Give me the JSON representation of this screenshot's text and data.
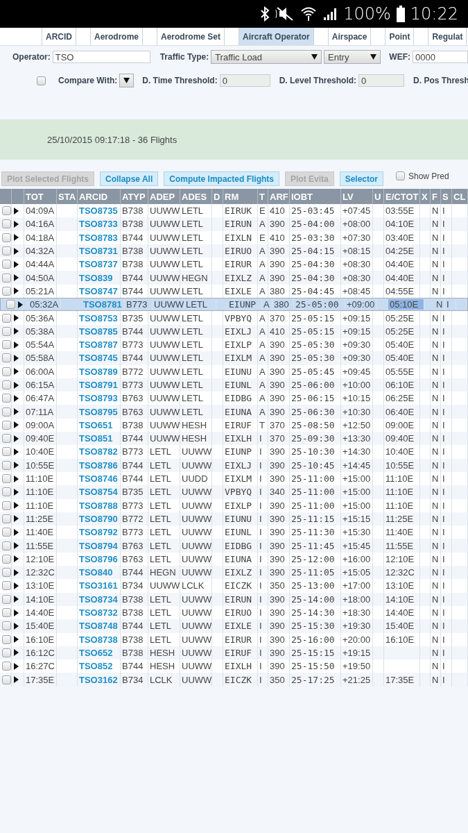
{
  "status_bar": {
    "battery": "100%",
    "time": "10:22"
  },
  "tabs": [
    {
      "label": "ARCID",
      "selected": false
    },
    {
      "label": "Aerodrome",
      "selected": false
    },
    {
      "label": "Aerodrome Set",
      "selected": false
    },
    {
      "label": "Aircraft Operator",
      "selected": true
    },
    {
      "label": "Airspace",
      "selected": false
    },
    {
      "label": "Point",
      "selected": false
    },
    {
      "label": "Regulat",
      "selected": false
    }
  ],
  "filters": {
    "operator": {
      "label": "Operator:",
      "value": "TSO"
    },
    "traffic_type": {
      "label": "Traffic Type:",
      "value": "Traffic Load",
      "mode": "Entry"
    },
    "wef": {
      "label": "WEF:",
      "value": "0000"
    },
    "compare": {
      "checked": false,
      "label": "Compare With:"
    },
    "time_threshold": {
      "label": "D. Time Threshold:",
      "value": "0"
    },
    "level_threshold": {
      "label": "D. Level Threshold:",
      "value": "0"
    },
    "pos_threshold": {
      "label": "D. Pos Thresh"
    }
  },
  "summary": "25/10/2015 09:17:18 - 36 Flights",
  "actions": [
    {
      "label": "Plot Selected Flights",
      "disabled": true
    },
    {
      "label": "Collapse All",
      "disabled": false
    },
    {
      "label": "Compute Impacted Flights",
      "disabled": false
    },
    {
      "label": "Plot Evita",
      "disabled": true
    },
    {
      "label": "Selector",
      "disabled": false
    }
  ],
  "show_pred": {
    "label": "Show Pred",
    "checked": false
  },
  "table": {
    "columns": [
      "TOT",
      "STA",
      "ARCID",
      "ATYP",
      "ADEP",
      "ADES",
      "D",
      "RM",
      "T",
      "ARF",
      "IOBT",
      "LV",
      "U",
      "E/CTOT",
      "X",
      "F",
      "S",
      "CL"
    ],
    "rows": [
      {
        "checked": false,
        "selected": false,
        "tot": "04:09A",
        "arcid": "TSO8735",
        "atyp": "B738",
        "adep": "UUWW",
        "ades": "LETL",
        "rm": "EIRUK",
        "t": "E",
        "arf": "410",
        "iobt": "25-03:45",
        "lv": "+07:45",
        "ctot": "03:55E",
        "f": "N",
        "s": "I"
      },
      {
        "checked": false,
        "selected": false,
        "tot": "04:16A",
        "arcid": "TSO8733",
        "atyp": "B738",
        "adep": "UUWW",
        "ades": "LETL",
        "rm": "EIRUN",
        "t": "A",
        "arf": "390",
        "iobt": "25-04:00",
        "lv": "+08:00",
        "ctot": "04:10E",
        "f": "N",
        "s": "I"
      },
      {
        "checked": false,
        "selected": false,
        "tot": "04:18A",
        "arcid": "TSO8783",
        "atyp": "B744",
        "adep": "UUWW",
        "ades": "LETL",
        "rm": "EIXLN",
        "t": "E",
        "arf": "410",
        "iobt": "25-03:30",
        "lv": "+07:30",
        "ctot": "03:40E",
        "f": "N",
        "s": "I"
      },
      {
        "checked": false,
        "selected": false,
        "tot": "04:32A",
        "arcid": "TSO8731",
        "atyp": "B738",
        "adep": "UUWW",
        "ades": "LETL",
        "rm": "EIRUO",
        "t": "A",
        "arf": "390",
        "iobt": "25-04:15",
        "lv": "+08:15",
        "ctot": "04:25E",
        "f": "N",
        "s": "I"
      },
      {
        "checked": false,
        "selected": false,
        "tot": "04:44A",
        "arcid": "TSO8737",
        "atyp": "B738",
        "adep": "UUWW",
        "ades": "LETL",
        "rm": "EIRUR",
        "t": "A",
        "arf": "390",
        "iobt": "25-04:30",
        "lv": "+08:30",
        "ctot": "04:40E",
        "f": "N",
        "s": "I"
      },
      {
        "checked": false,
        "selected": false,
        "tot": "04:50A",
        "arcid": "TSO839",
        "atyp": "B744",
        "adep": "UUWW",
        "ades": "HEGN",
        "rm": "EIXLZ",
        "t": "A",
        "arf": "390",
        "iobt": "25-04:30",
        "lv": "+08:30",
        "ctot": "04:40E",
        "f": "N",
        "s": "I"
      },
      {
        "checked": false,
        "selected": false,
        "tot": "05:21A",
        "arcid": "TSO8747",
        "atyp": "B744",
        "adep": "UUWW",
        "ades": "LETL",
        "rm": "EIXLE",
        "t": "A",
        "arf": "380",
        "iobt": "25-04:45",
        "lv": "+08:45",
        "ctot": "04:55E",
        "f": "N",
        "s": "I"
      },
      {
        "checked": false,
        "selected": true,
        "tot": "05:32A",
        "arcid": "TSO8781",
        "atyp": "B773",
        "adep": "UUWW",
        "ades": "LETL",
        "rm": "EIUNP",
        "t": "A",
        "arf": "380",
        "iobt": "25-05:00",
        "lv": "+09:00",
        "ctot": "05:10E",
        "f": "N",
        "s": "I"
      },
      {
        "checked": false,
        "selected": false,
        "tot": "05:36A",
        "arcid": "TSO8753",
        "atyp": "B735",
        "adep": "UUWW",
        "ades": "LETL",
        "rm": "VPBYQ",
        "t": "A",
        "arf": "370",
        "iobt": "25-05:15",
        "lv": "+09:15",
        "ctot": "05:25E",
        "f": "N",
        "s": "I"
      },
      {
        "checked": false,
        "selected": false,
        "tot": "05:38A",
        "arcid": "TSO8785",
        "atyp": "B744",
        "adep": "UUWW",
        "ades": "LETL",
        "rm": "EIXLJ",
        "t": "A",
        "arf": "410",
        "iobt": "25-05:15",
        "lv": "+09:15",
        "ctot": "05:25E",
        "f": "N",
        "s": "I"
      },
      {
        "checked": false,
        "selected": false,
        "tot": "05:54A",
        "arcid": "TSO8787",
        "atyp": "B773",
        "adep": "UUWW",
        "ades": "LETL",
        "rm": "EIXLP",
        "t": "A",
        "arf": "390",
        "iobt": "25-05:30",
        "lv": "+09:30",
        "ctot": "05:40E",
        "f": "N",
        "s": "I"
      },
      {
        "checked": false,
        "selected": false,
        "tot": "05:58A",
        "arcid": "TSO8745",
        "atyp": "B744",
        "adep": "UUWW",
        "ades": "LETL",
        "rm": "EIXLM",
        "t": "A",
        "arf": "390",
        "iobt": "25-05:30",
        "lv": "+09:30",
        "ctot": "05:40E",
        "f": "N",
        "s": "I"
      },
      {
        "checked": false,
        "selected": false,
        "tot": "06:00A",
        "arcid": "TSO8789",
        "atyp": "B772",
        "adep": "UUWW",
        "ades": "LETL",
        "rm": "EIUNU",
        "t": "A",
        "arf": "390",
        "iobt": "25-05:45",
        "lv": "+09:45",
        "ctot": "05:55E",
        "f": "N",
        "s": "I"
      },
      {
        "checked": false,
        "selected": false,
        "tot": "06:15A",
        "arcid": "TSO8791",
        "atyp": "B773",
        "adep": "UUWW",
        "ades": "LETL",
        "rm": "EIUNL",
        "t": "A",
        "arf": "390",
        "iobt": "25-06:00",
        "lv": "+10:00",
        "ctot": "06:10E",
        "f": "N",
        "s": "I"
      },
      {
        "checked": false,
        "selected": false,
        "tot": "06:47A",
        "arcid": "TSO8793",
        "atyp": "B763",
        "adep": "UUWW",
        "ades": "LETL",
        "rm": "EIDBG",
        "t": "A",
        "arf": "390",
        "iobt": "25-06:15",
        "lv": "+10:15",
        "ctot": "06:25E",
        "f": "N",
        "s": "I"
      },
      {
        "checked": false,
        "selected": false,
        "tot": "07:11A",
        "arcid": "TSO8795",
        "atyp": "B763",
        "adep": "UUWW",
        "ades": "LETL",
        "rm": "EIUNA",
        "t": "A",
        "arf": "390",
        "iobt": "25-06:30",
        "lv": "+10:30",
        "ctot": "06:40E",
        "f": "N",
        "s": "I"
      },
      {
        "checked": false,
        "selected": false,
        "tot": "09:00A",
        "arcid": "TSO651",
        "atyp": "B738",
        "adep": "UUWW",
        "ades": "HESH",
        "rm": "EIRUF",
        "t": "T",
        "arf": "370",
        "iobt": "25-08:50",
        "lv": "+12:50",
        "ctot": "09:00E",
        "f": "N",
        "s": "I"
      },
      {
        "checked": false,
        "selected": false,
        "tot": "09:40E",
        "arcid": "TSO851",
        "atyp": "B744",
        "adep": "UUWW",
        "ades": "HESH",
        "rm": "EIXLH",
        "t": "I",
        "arf": "370",
        "iobt": "25-09:30",
        "lv": "+13:30",
        "ctot": "09:40E",
        "f": "N",
        "s": "I"
      },
      {
        "checked": false,
        "selected": false,
        "tot": "10:40E",
        "arcid": "TSO8782",
        "atyp": "B773",
        "adep": "LETL",
        "ades": "UUWW",
        "rm": "EIUNP",
        "t": "I",
        "arf": "390",
        "iobt": "25-10:30",
        "lv": "+14:30",
        "ctot": "10:40E",
        "f": "N",
        "s": "I"
      },
      {
        "checked": false,
        "selected": false,
        "tot": "10:55E",
        "arcid": "TSO8786",
        "atyp": "B744",
        "adep": "LETL",
        "ades": "UUWW",
        "rm": "EIXLJ",
        "t": "I",
        "arf": "390",
        "iobt": "25-10:45",
        "lv": "+14:45",
        "ctot": "10:55E",
        "f": "N",
        "s": "I"
      },
      {
        "checked": false,
        "selected": false,
        "tot": "11:10E",
        "arcid": "TSO8746",
        "atyp": "B744",
        "adep": "LETL",
        "ades": "UUDD",
        "rm": "EIXLM",
        "t": "I",
        "arf": "390",
        "iobt": "25-11:00",
        "lv": "+15:00",
        "ctot": "11:10E",
        "f": "N",
        "s": "I"
      },
      {
        "checked": false,
        "selected": false,
        "tot": "11:10E",
        "arcid": "TSO8754",
        "atyp": "B735",
        "adep": "LETL",
        "ades": "UUWW",
        "rm": "VPBYQ",
        "t": "I",
        "arf": "340",
        "iobt": "25-11:00",
        "lv": "+15:00",
        "ctot": "11:10E",
        "f": "N",
        "s": "I"
      },
      {
        "checked": false,
        "selected": false,
        "tot": "11:10E",
        "arcid": "TSO8788",
        "atyp": "B773",
        "adep": "LETL",
        "ades": "UUWW",
        "rm": "EIXLP",
        "t": "I",
        "arf": "390",
        "iobt": "25-11:00",
        "lv": "+15:00",
        "ctot": "11:10E",
        "f": "N",
        "s": "I"
      },
      {
        "checked": false,
        "selected": false,
        "tot": "11:25E",
        "arcid": "TSO8790",
        "atyp": "B772",
        "adep": "LETL",
        "ades": "UUWW",
        "rm": "EIUNU",
        "t": "I",
        "arf": "390",
        "iobt": "25-11:15",
        "lv": "+15:15",
        "ctot": "11:25E",
        "f": "N",
        "s": "I"
      },
      {
        "checked": false,
        "selected": false,
        "tot": "11:40E",
        "arcid": "TSO8792",
        "atyp": "B773",
        "adep": "LETL",
        "ades": "UUWW",
        "rm": "EIUNL",
        "t": "I",
        "arf": "390",
        "iobt": "25-11:30",
        "lv": "+15:30",
        "ctot": "11:40E",
        "f": "N",
        "s": "I"
      },
      {
        "checked": false,
        "selected": false,
        "tot": "11:55E",
        "arcid": "TSO8794",
        "atyp": "B763",
        "adep": "LETL",
        "ades": "UUWW",
        "rm": "EIDBG",
        "t": "I",
        "arf": "390",
        "iobt": "25-11:45",
        "lv": "+15:45",
        "ctot": "11:55E",
        "f": "N",
        "s": "I"
      },
      {
        "checked": false,
        "selected": false,
        "tot": "12:10E",
        "arcid": "TSO8796",
        "atyp": "B763",
        "adep": "LETL",
        "ades": "UUWW",
        "rm": "EIUNA",
        "t": "I",
        "arf": "390",
        "iobt": "25-12:00",
        "lv": "+16:00",
        "ctot": "12:10E",
        "f": "N",
        "s": "I"
      },
      {
        "checked": false,
        "selected": false,
        "tot": "12:32C",
        "arcid": "TSO840",
        "atyp": "B744",
        "adep": "HEGN",
        "ades": "UUWW",
        "rm": "EIXLZ",
        "t": "I",
        "arf": "390",
        "iobt": "25-11:05",
        "lv": "+15:05",
        "ctot": "12:32C",
        "f": "N",
        "s": "I"
      },
      {
        "checked": false,
        "selected": false,
        "tot": "13:10E",
        "arcid": "TSO3161",
        "atyp": "B734",
        "adep": "UUWW",
        "ades": "LCLK",
        "rm": "EICZK",
        "t": "I",
        "arf": "350",
        "iobt": "25-13:00",
        "lv": "+17:00",
        "ctot": "13:10E",
        "f": "N",
        "s": "I"
      },
      {
        "checked": false,
        "selected": false,
        "tot": "14:10E",
        "arcid": "TSO8734",
        "atyp": "B738",
        "adep": "LETL",
        "ades": "UUWW",
        "rm": "EIRUN",
        "t": "I",
        "arf": "390",
        "iobt": "25-14:00",
        "lv": "+18:00",
        "ctot": "14:10E",
        "f": "N",
        "s": "I"
      },
      {
        "checked": false,
        "selected": false,
        "tot": "14:40E",
        "arcid": "TSO8732",
        "atyp": "B738",
        "adep": "LETL",
        "ades": "UUWW",
        "rm": "EIRUO",
        "t": "I",
        "arf": "390",
        "iobt": "25-14:30",
        "lv": "+18:30",
        "ctot": "14:40E",
        "f": "N",
        "s": "I"
      },
      {
        "checked": false,
        "selected": false,
        "tot": "15:40E",
        "arcid": "TSO8748",
        "atyp": "B744",
        "adep": "LETL",
        "ades": "UUWW",
        "rm": "EIXLE",
        "t": "I",
        "arf": "390",
        "iobt": "25-15:30",
        "lv": "+19:30",
        "ctot": "15:40E",
        "f": "N",
        "s": "I"
      },
      {
        "checked": false,
        "selected": false,
        "tot": "16:10E",
        "arcid": "TSO8738",
        "atyp": "B738",
        "adep": "LETL",
        "ades": "UUWW",
        "rm": "EIRUR",
        "t": "I",
        "arf": "390",
        "iobt": "25-16:00",
        "lv": "+20:00",
        "ctot": "16:10E",
        "f": "N",
        "s": "I"
      },
      {
        "checked": false,
        "selected": false,
        "tot": "16:12C",
        "arcid": "TSO652",
        "atyp": "B738",
        "adep": "HESH",
        "ades": "UUWW",
        "rm": "EIRUF",
        "t": "I",
        "arf": "390",
        "iobt": "25-15:15",
        "lv": "+19:15",
        "f": "N",
        "s": "I"
      },
      {
        "checked": false,
        "selected": false,
        "tot": "16:27C",
        "arcid": "TSO852",
        "atyp": "B744",
        "adep": "HESH",
        "ades": "UUWW",
        "rm": "EIXLH",
        "t": "I",
        "arf": "390",
        "iobt": "25-15:50",
        "lv": "+19:50",
        "f": "N",
        "s": "I"
      },
      {
        "checked": false,
        "selected": false,
        "tot": "17:35E",
        "arcid": "TSO3162",
        "atyp": "B734",
        "adep": "LCLK",
        "ades": "UUWW",
        "rm": "EICZK",
        "t": "I",
        "arf": "350",
        "iobt": "25-17:25",
        "lv": "+21:25",
        "ctot": "17:35E",
        "f": "N",
        "s": "I"
      }
    ]
  }
}
